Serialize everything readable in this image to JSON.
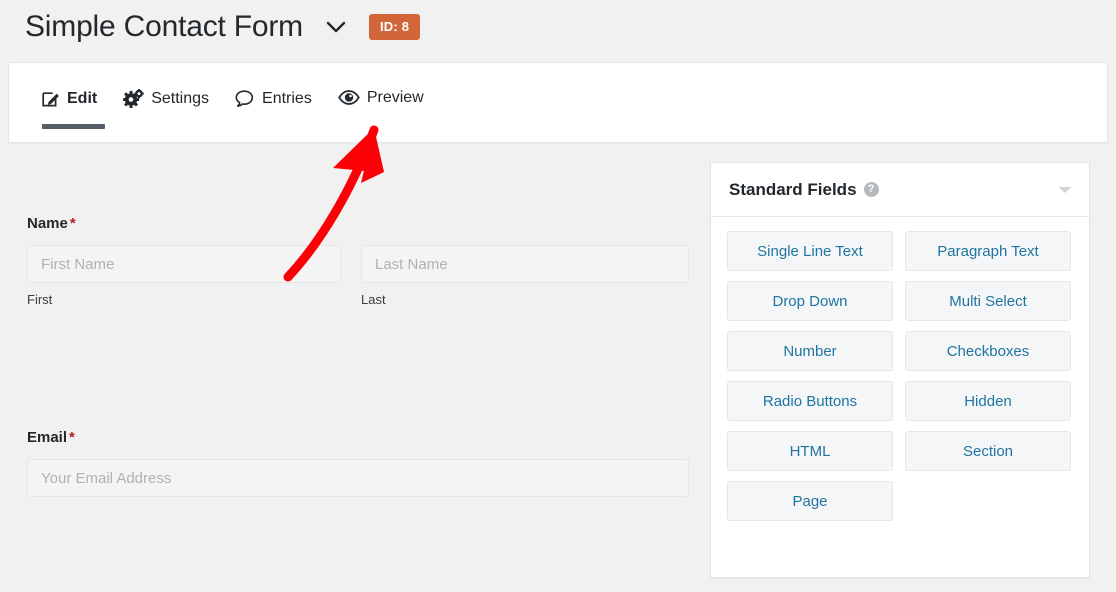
{
  "header": {
    "title": "Simple Contact Form",
    "chevron_icon": "chevron-down-icon",
    "id_badge": "ID: 8",
    "badge_color": "#d2663a"
  },
  "tabs": [
    {
      "label": "Edit",
      "icon": "edit-pencil-icon",
      "active": true
    },
    {
      "label": "Settings",
      "icon": "gears-icon",
      "active": false
    },
    {
      "label": "Entries",
      "icon": "speech-bubble-icon",
      "active": false
    },
    {
      "label": "Preview",
      "icon": "eye-icon",
      "active": false
    }
  ],
  "form_preview": {
    "name_field": {
      "label": "Name",
      "required_mark": "*",
      "first": {
        "placeholder": "First Name",
        "sublabel": "First"
      },
      "last": {
        "placeholder": "Last Name",
        "sublabel": "Last"
      }
    },
    "email_field": {
      "label": "Email",
      "required_mark": "*",
      "placeholder": "Your Email Address"
    }
  },
  "standard_fields_panel": {
    "title": "Standard Fields",
    "help_icon": "question-mark-icon",
    "help_glyph": "?",
    "collapse_icon": "chevron-down-icon",
    "buttons": [
      "Single Line Text",
      "Paragraph Text",
      "Drop Down",
      "Multi Select",
      "Number",
      "Checkboxes",
      "Radio Buttons",
      "Hidden",
      "HTML",
      "Section",
      "Page"
    ],
    "button_text_color": "#1f74a0"
  },
  "annotation": {
    "type": "arrow",
    "color": "#fb0007",
    "points_to": "Preview"
  }
}
